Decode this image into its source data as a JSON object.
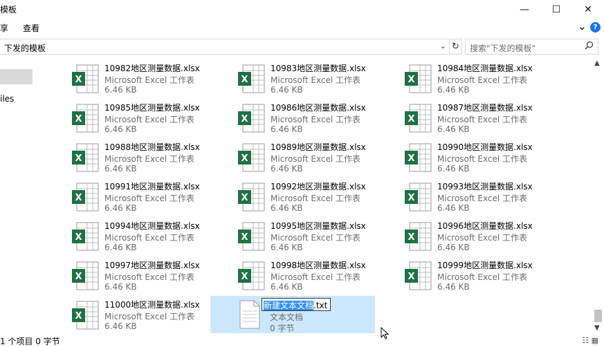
{
  "window": {
    "title": "模板",
    "minimize": "—",
    "maximize": "☐",
    "close": "✕"
  },
  "ribbon": {
    "tab_share": "享",
    "tab_view": "查看",
    "expand": "⌄",
    "help": "?"
  },
  "address": {
    "path": "下发的模板",
    "dropdown": "⌄",
    "refresh": "↻",
    "search_placeholder": "搜索\"下发的模板\"",
    "search_icon": "search-icon"
  },
  "nav": {
    "files_label": "iles"
  },
  "files": [
    {
      "name": "10982地区测量数据.xlsx",
      "type": "Microsoft Excel 工作表",
      "size": "6.46 KB"
    },
    {
      "name": "10983地区测量数据.xlsx",
      "type": "Microsoft Excel 工作表",
      "size": "6.46 KB"
    },
    {
      "name": "10984地区测量数据.xlsx",
      "type": "Microsoft Excel 工作表",
      "size": "6.46 KB"
    },
    {
      "name": "10985地区测量数据.xlsx",
      "type": "Microsoft Excel 工作表",
      "size": "6.46 KB"
    },
    {
      "name": "10986地区测量数据.xlsx",
      "type": "Microsoft Excel 工作表",
      "size": "6.46 KB"
    },
    {
      "name": "10987地区测量数据.xlsx",
      "type": "Microsoft Excel 工作表",
      "size": "6.46 KB"
    },
    {
      "name": "10988地区测量数据.xlsx",
      "type": "Microsoft Excel 工作表",
      "size": "6.46 KB"
    },
    {
      "name": "10989地区测量数据.xlsx",
      "type": "Microsoft Excel 工作表",
      "size": "6.46 KB"
    },
    {
      "name": "10990地区测量数据.xlsx",
      "type": "Microsoft Excel 工作表",
      "size": "6.46 KB"
    },
    {
      "name": "10991地区测量数据.xlsx",
      "type": "Microsoft Excel 工作表",
      "size": "6.46 KB"
    },
    {
      "name": "10992地区测量数据.xlsx",
      "type": "Microsoft Excel 工作表",
      "size": "6.46 KB"
    },
    {
      "name": "10993地区测量数据.xlsx",
      "type": "Microsoft Excel 工作表",
      "size": "6.46 KB"
    },
    {
      "name": "10994地区测量数据.xlsx",
      "type": "Microsoft Excel 工作表",
      "size": "6.46 KB"
    },
    {
      "name": "10995地区测量数据.xlsx",
      "type": "Microsoft Excel 工作表",
      "size": "6.46 KB"
    },
    {
      "name": "10996地区测量数据.xlsx",
      "type": "Microsoft Excel 工作表",
      "size": "6.46 KB"
    },
    {
      "name": "10997地区测量数据.xlsx",
      "type": "Microsoft Excel 工作表",
      "size": "6.46 KB"
    },
    {
      "name": "10998地区测量数据.xlsx",
      "type": "Microsoft Excel 工作表",
      "size": "6.46 KB"
    },
    {
      "name": "10999地区测量数据.xlsx",
      "type": "Microsoft Excel 工作表",
      "size": "6.46 KB"
    },
    {
      "name": "11000地区测量数据.xlsx",
      "type": "Microsoft Excel 工作表",
      "size": "6.46 KB"
    }
  ],
  "new_file": {
    "name_selected": "新建文本文档",
    "name_ext": ".txt",
    "type": "文本文档",
    "size": "0 字节"
  },
  "status": {
    "text": "1 个项目  0 字节"
  },
  "colors": {
    "excel_green": "#1e7145",
    "selection": "#cce8ff",
    "rename_highlight": "#3390ff"
  }
}
